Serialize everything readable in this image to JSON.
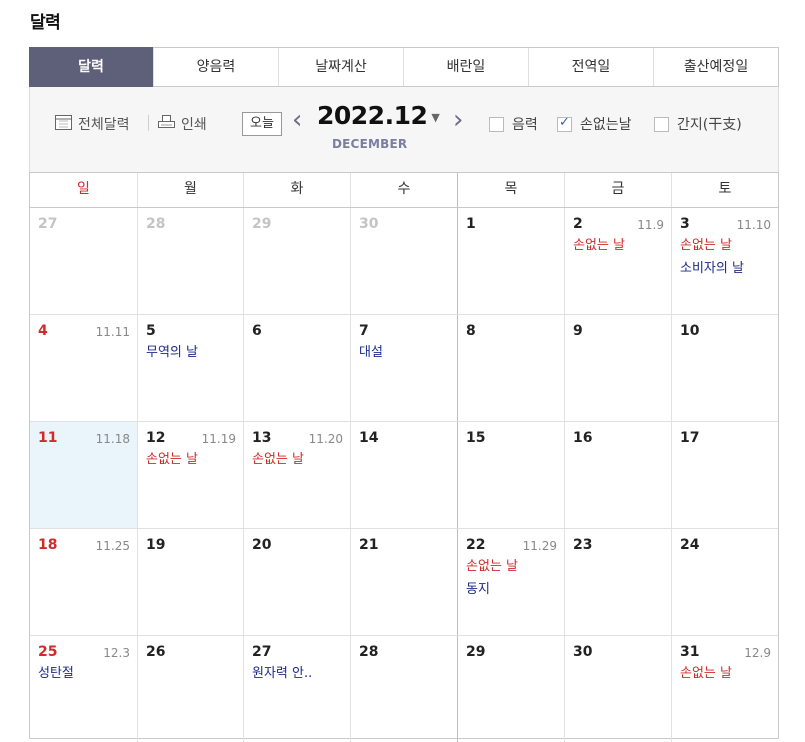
{
  "page_title": "달력",
  "tabs": [
    {
      "label": "달력",
      "active": true
    },
    {
      "label": "양음력",
      "active": false
    },
    {
      "label": "날짜계산",
      "active": false
    },
    {
      "label": "배란일",
      "active": false
    },
    {
      "label": "전역일",
      "active": false
    },
    {
      "label": "출산예정일",
      "active": false
    }
  ],
  "toolbar": {
    "full_calendar": "전체달력",
    "print": "인쇄",
    "today": "오늘",
    "month": "2022.12",
    "month_en": "DECEMBER",
    "lunar_label": "음력",
    "lunar_checked": false,
    "sonless_label": "손없는날",
    "sonless_checked": true,
    "ganji_label": "간지(干支)",
    "ganji_checked": false
  },
  "weekdays": [
    "일",
    "월",
    "화",
    "수",
    "목",
    "금",
    "토"
  ],
  "weeks": [
    [
      {
        "day": "27",
        "other": true
      },
      {
        "day": "28",
        "other": true
      },
      {
        "day": "29",
        "other": true
      },
      {
        "day": "30",
        "other": true
      },
      {
        "day": "1"
      },
      {
        "day": "2",
        "lunar": "11.9",
        "red": "손없는 날"
      },
      {
        "day": "3",
        "lunar": "11.10",
        "red": "손없는 날",
        "blue": "소비자의 날"
      }
    ],
    [
      {
        "day": "4",
        "lunar": "11.11",
        "sun": true
      },
      {
        "day": "5",
        "blue": "무역의 날"
      },
      {
        "day": "6"
      },
      {
        "day": "7",
        "blue": "대설"
      },
      {
        "day": "8"
      },
      {
        "day": "9"
      },
      {
        "day": "10"
      }
    ],
    [
      {
        "day": "11",
        "lunar": "11.18",
        "sun": true,
        "today": true
      },
      {
        "day": "12",
        "lunar": "11.19",
        "red": "손없는 날"
      },
      {
        "day": "13",
        "lunar": "11.20",
        "red": "손없는 날"
      },
      {
        "day": "14"
      },
      {
        "day": "15"
      },
      {
        "day": "16"
      },
      {
        "day": "17"
      }
    ],
    [
      {
        "day": "18",
        "lunar": "11.25",
        "sun": true
      },
      {
        "day": "19"
      },
      {
        "day": "20"
      },
      {
        "day": "21"
      },
      {
        "day": "22",
        "lunar": "11.29",
        "red": "손없는 날",
        "blue": "동지"
      },
      {
        "day": "23"
      },
      {
        "day": "24"
      }
    ],
    [
      {
        "day": "25",
        "lunar": "12.3",
        "sun": true,
        "blue": "성탄절"
      },
      {
        "day": "26"
      },
      {
        "day": "27",
        "blue": "원자력 안.."
      },
      {
        "day": "28"
      },
      {
        "day": "29"
      },
      {
        "day": "30"
      },
      {
        "day": "31",
        "lunar": "12.9",
        "red": "손없는 날"
      }
    ]
  ],
  "colors": {
    "accent": "#5e6079",
    "sunday": "#d02a2a",
    "holiday": "#1c2b8a",
    "today_bg": "#eaf4fb"
  }
}
